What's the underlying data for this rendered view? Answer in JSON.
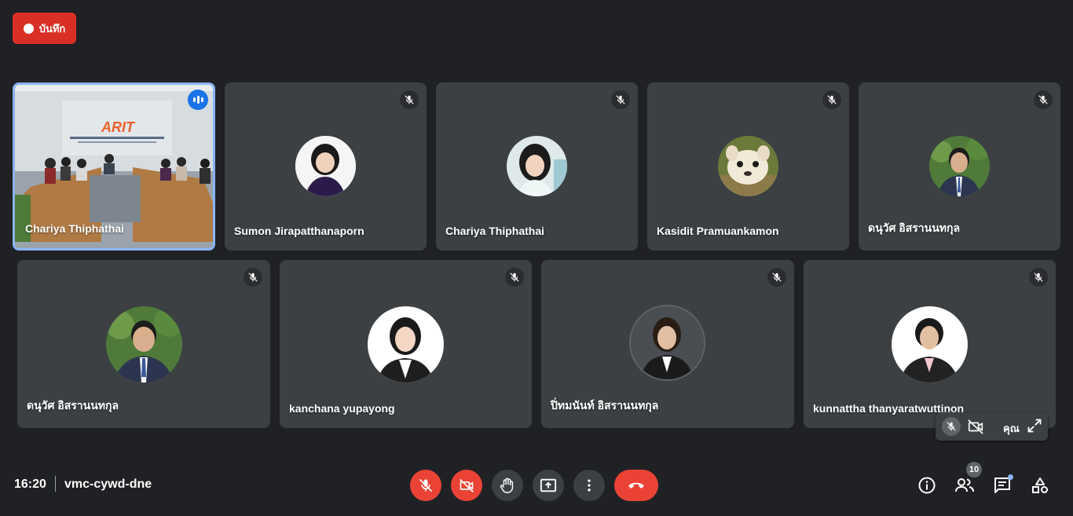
{
  "record": {
    "label": "บันทึก"
  },
  "tiles": [
    {
      "name": "Chariya Thiphathai"
    },
    {
      "name": "Sumon Jirapatthanaporn"
    },
    {
      "name": "Chariya Thiphathai"
    },
    {
      "name": "Kasidit Pramuankamon"
    },
    {
      "name": "ดนุวัศ อิสรานนทกุล"
    },
    {
      "name": "ดนุวัศ อิสรานนทกุล"
    },
    {
      "name": "kanchana yupayong"
    },
    {
      "name": "ปิ่ทมนันท์ อิสรานนทกุล"
    },
    {
      "name": "kunnattha thanyaratwuttinon"
    }
  ],
  "room_sign": {
    "logo": "ARIT"
  },
  "self_view": {
    "label": "คุณ"
  },
  "meeting": {
    "time": "16:20",
    "code": "vmc-cywd-dne"
  },
  "controls": [
    "mic-off-icon",
    "camera-off-icon",
    "raise-hand-icon",
    "present-icon",
    "more-icon",
    "hang-up-icon"
  ],
  "right_controls": {
    "people_count": "10",
    "icons": [
      "info-icon",
      "people-icon",
      "chat-icon",
      "activities-icon"
    ]
  },
  "colors": {
    "background": "#202124",
    "tile": "#3c4043",
    "red": "#ea4335",
    "record": "#d93025",
    "speaking": "#1a73e8",
    "active_border": "#8ab4f8"
  }
}
